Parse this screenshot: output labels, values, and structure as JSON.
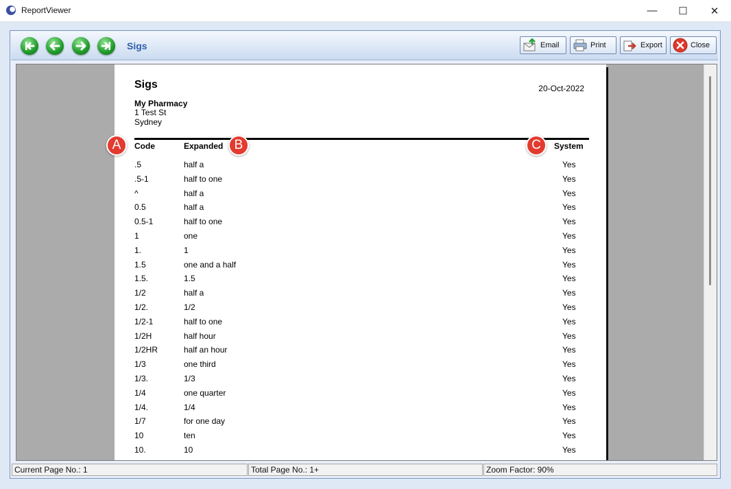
{
  "window": {
    "title": "ReportViewer",
    "controls": {
      "minimize": "—",
      "maximize": "☐",
      "close": "✕"
    }
  },
  "toolbar": {
    "title": "Sigs",
    "nav": [
      "first-page",
      "previous-page",
      "next-page",
      "last-page"
    ],
    "buttons": {
      "email": "Email",
      "print": "Print",
      "export": "Export",
      "close": "Close"
    }
  },
  "report": {
    "title": "Sigs",
    "date": "20-Oct-2022",
    "pharmacy": {
      "name": "My Pharmacy",
      "address1": "1 Test St",
      "address2": "Sydney"
    },
    "columns": {
      "code": "Code",
      "expanded": "Expanded",
      "system": "System"
    },
    "rows": [
      {
        "code": ".5",
        "expanded": "half a",
        "system": "Yes"
      },
      {
        "code": ".5-1",
        "expanded": "half to one",
        "system": "Yes"
      },
      {
        "code": "^",
        "expanded": "half a",
        "system": "Yes"
      },
      {
        "code": "0.5",
        "expanded": "half a",
        "system": "Yes"
      },
      {
        "code": "0.5-1",
        "expanded": "half to one",
        "system": "Yes"
      },
      {
        "code": "1",
        "expanded": "one",
        "system": "Yes"
      },
      {
        "code": "1.",
        "expanded": "1",
        "system": "Yes"
      },
      {
        "code": "1.5",
        "expanded": "one and a half",
        "system": "Yes"
      },
      {
        "code": "1.5.",
        "expanded": "1.5",
        "system": "Yes"
      },
      {
        "code": "1/2",
        "expanded": "half a",
        "system": "Yes"
      },
      {
        "code": "1/2.",
        "expanded": "1/2",
        "system": "Yes"
      },
      {
        "code": "1/2-1",
        "expanded": "half to one",
        "system": "Yes"
      },
      {
        "code": "1/2H",
        "expanded": "half hour",
        "system": "Yes"
      },
      {
        "code": "1/2HR",
        "expanded": "half an hour",
        "system": "Yes"
      },
      {
        "code": "1/3",
        "expanded": "one third",
        "system": "Yes"
      },
      {
        "code": "1/3.",
        "expanded": "1/3",
        "system": "Yes"
      },
      {
        "code": "1/4",
        "expanded": "one quarter",
        "system": "Yes"
      },
      {
        "code": "1/4.",
        "expanded": "1/4",
        "system": "Yes"
      },
      {
        "code": "1/7",
        "expanded": "for one day",
        "system": "Yes"
      },
      {
        "code": "10",
        "expanded": "ten",
        "system": "Yes"
      },
      {
        "code": "10.",
        "expanded": "10",
        "system": "Yes"
      }
    ]
  },
  "markers": {
    "a": "A",
    "b": "B",
    "c": "C"
  },
  "status": {
    "current_page": "Current Page No.: 1",
    "total_pages": "Total Page No.: 1+",
    "zoom": "Zoom Factor: 90%"
  },
  "colors": {
    "toolbar_title": "#2f5faa",
    "marker": "#e33b2f",
    "nav_button": "#1f9a2a"
  }
}
